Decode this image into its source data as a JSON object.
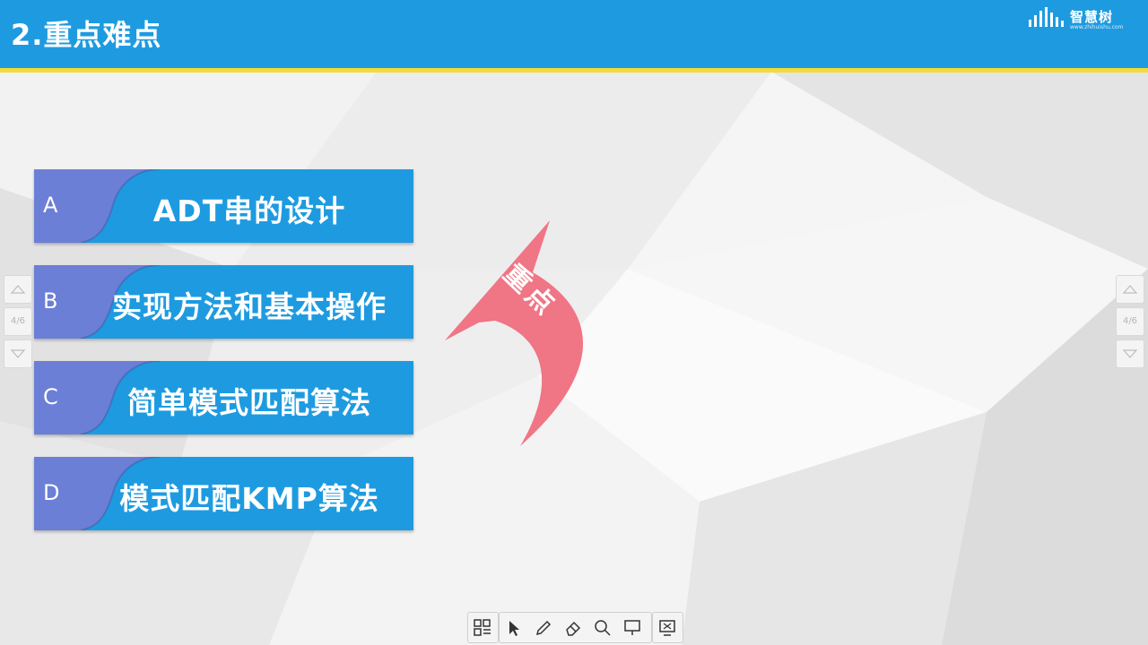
{
  "header": {
    "title": "2.重点难点",
    "logo_text": "智慧树",
    "logo_sub": "www.zhihuishu.com"
  },
  "items": [
    {
      "letter": "A",
      "label": "ADT串的设计"
    },
    {
      "letter": "B",
      "label": "实现方法和基本操作"
    },
    {
      "letter": "C",
      "label": "简单模式匹配算法"
    },
    {
      "letter": "D",
      "label": "模式匹配KMP算法"
    }
  ],
  "callout": {
    "label": "重点"
  },
  "page_indicator": {
    "left": "4/6",
    "right": "4/6"
  },
  "toolbar": {
    "tools": [
      "grid-icon",
      "cursor-icon",
      "pen-icon",
      "eraser-icon",
      "search-icon",
      "screen-icon",
      "whiteboard-icon"
    ]
  },
  "colors": {
    "header": "#1e9be0",
    "stripe": "#f5d93a",
    "item_blue": "#1e9be0",
    "item_tab": "#6b7fd6",
    "arrow": "#f07585"
  }
}
